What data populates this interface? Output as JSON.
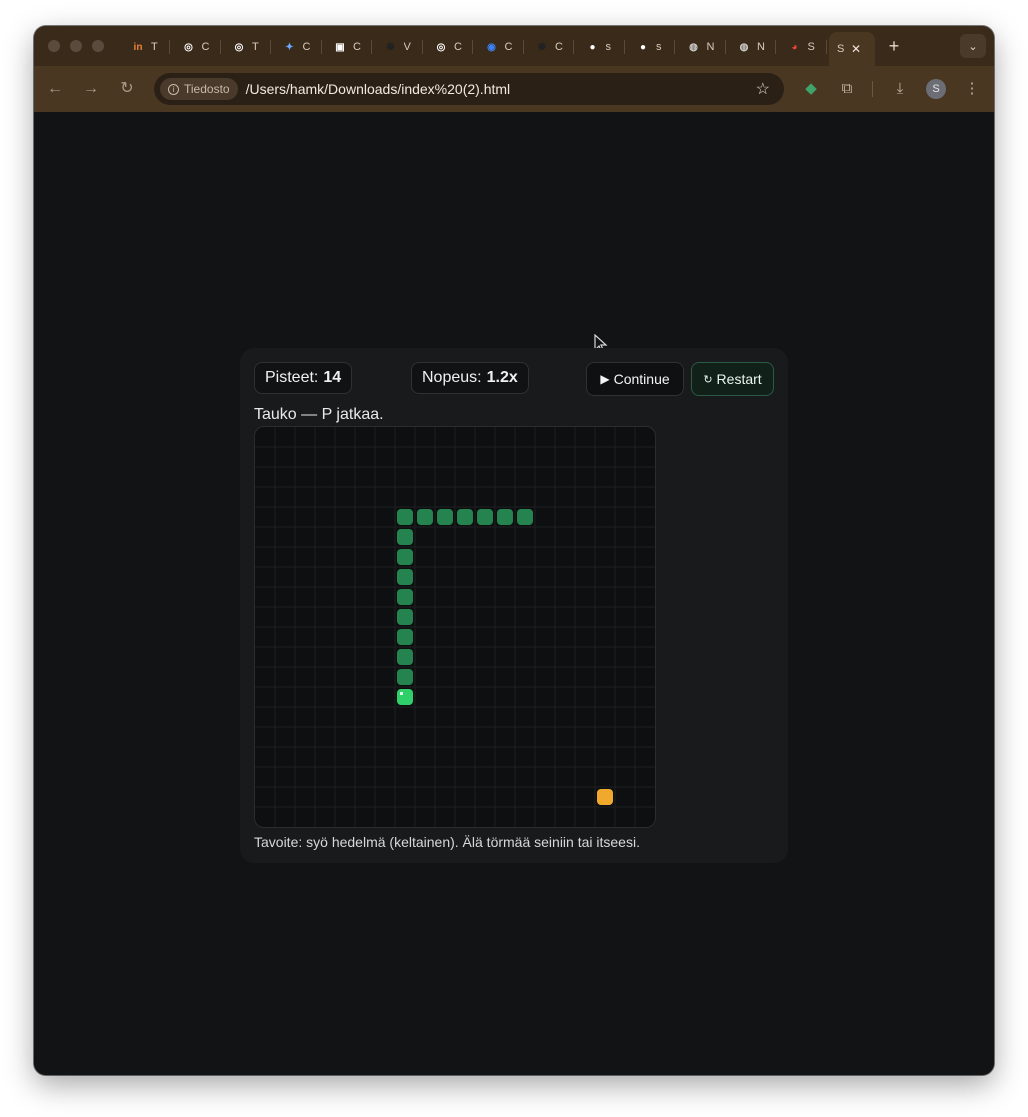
{
  "browser": {
    "tabs": [
      {
        "icon": "inflection-icon",
        "glyph": "in",
        "title": "T",
        "color": "#e8843a"
      },
      {
        "icon": "openai-icon",
        "glyph": "◎",
        "title": "C",
        "color": "#ffffff"
      },
      {
        "icon": "perplexity-icon",
        "glyph": "◎",
        "title": "T",
        "color": "#ffffff"
      },
      {
        "icon": "gemini-icon",
        "glyph": "✦",
        "title": "C",
        "color": "#6aa9ff"
      },
      {
        "icon": "app-icon",
        "glyph": "▣",
        "title": "C",
        "color": "#ffffff"
      },
      {
        "icon": "openai-icon",
        "glyph": "✺",
        "title": "V",
        "color": "#222222"
      },
      {
        "icon": "openai-icon",
        "glyph": "◎",
        "title": "C",
        "color": "#ffffff"
      },
      {
        "icon": "app-icon",
        "glyph": "◉",
        "title": "C",
        "color": "#3b82f6"
      },
      {
        "icon": "openai-icon",
        "glyph": "✺",
        "title": "C",
        "color": "#222222"
      },
      {
        "icon": "github-icon",
        "glyph": "●",
        "title": "s",
        "color": "#ffffff"
      },
      {
        "icon": "github-icon",
        "glyph": "●",
        "title": "s",
        "color": "#ffffff"
      },
      {
        "icon": "globe-icon",
        "glyph": "◍",
        "title": "N",
        "color": "#cfcfcf"
      },
      {
        "icon": "globe-icon",
        "glyph": "◍",
        "title": "N",
        "color": "#cfcfcf"
      },
      {
        "icon": "chrome-icon",
        "glyph": "◕",
        "title": "S",
        "color": "#e8453c"
      },
      {
        "icon": "",
        "glyph": "",
        "title": "S",
        "color": "#ffffff",
        "active": true
      }
    ],
    "security_chip": "Tiedosto",
    "url": "/Users/hamk/Downloads/index%20(2).html",
    "profile_initial": "S"
  },
  "game": {
    "score_label": "Pisteet:",
    "score": "14",
    "speed_label": "Nopeus:",
    "speed": "1.2x",
    "continue_label": "Continue",
    "restart_label": "Restart",
    "status": "Tauko — P jatkaa.",
    "goal": "Tavoite: syö hedelmä (keltainen). Älä törmää seiniin tai itseesi.",
    "colors": {
      "snake_body": "#24834f",
      "snake_head": "#2fcf6a",
      "fruit": "#f0a92c",
      "grid": "#1d1f21"
    },
    "grid_cells": 20,
    "snake": [
      [
        7,
        13
      ],
      [
        7,
        12
      ],
      [
        7,
        11
      ],
      [
        7,
        10
      ],
      [
        7,
        9
      ],
      [
        7,
        8
      ],
      [
        7,
        7
      ],
      [
        7,
        6
      ],
      [
        7,
        5
      ],
      [
        7,
        4
      ],
      [
        8,
        4
      ],
      [
        9,
        4
      ],
      [
        10,
        4
      ],
      [
        11,
        4
      ],
      [
        12,
        4
      ],
      [
        13,
        4
      ]
    ],
    "fruit": [
      17,
      18
    ]
  }
}
